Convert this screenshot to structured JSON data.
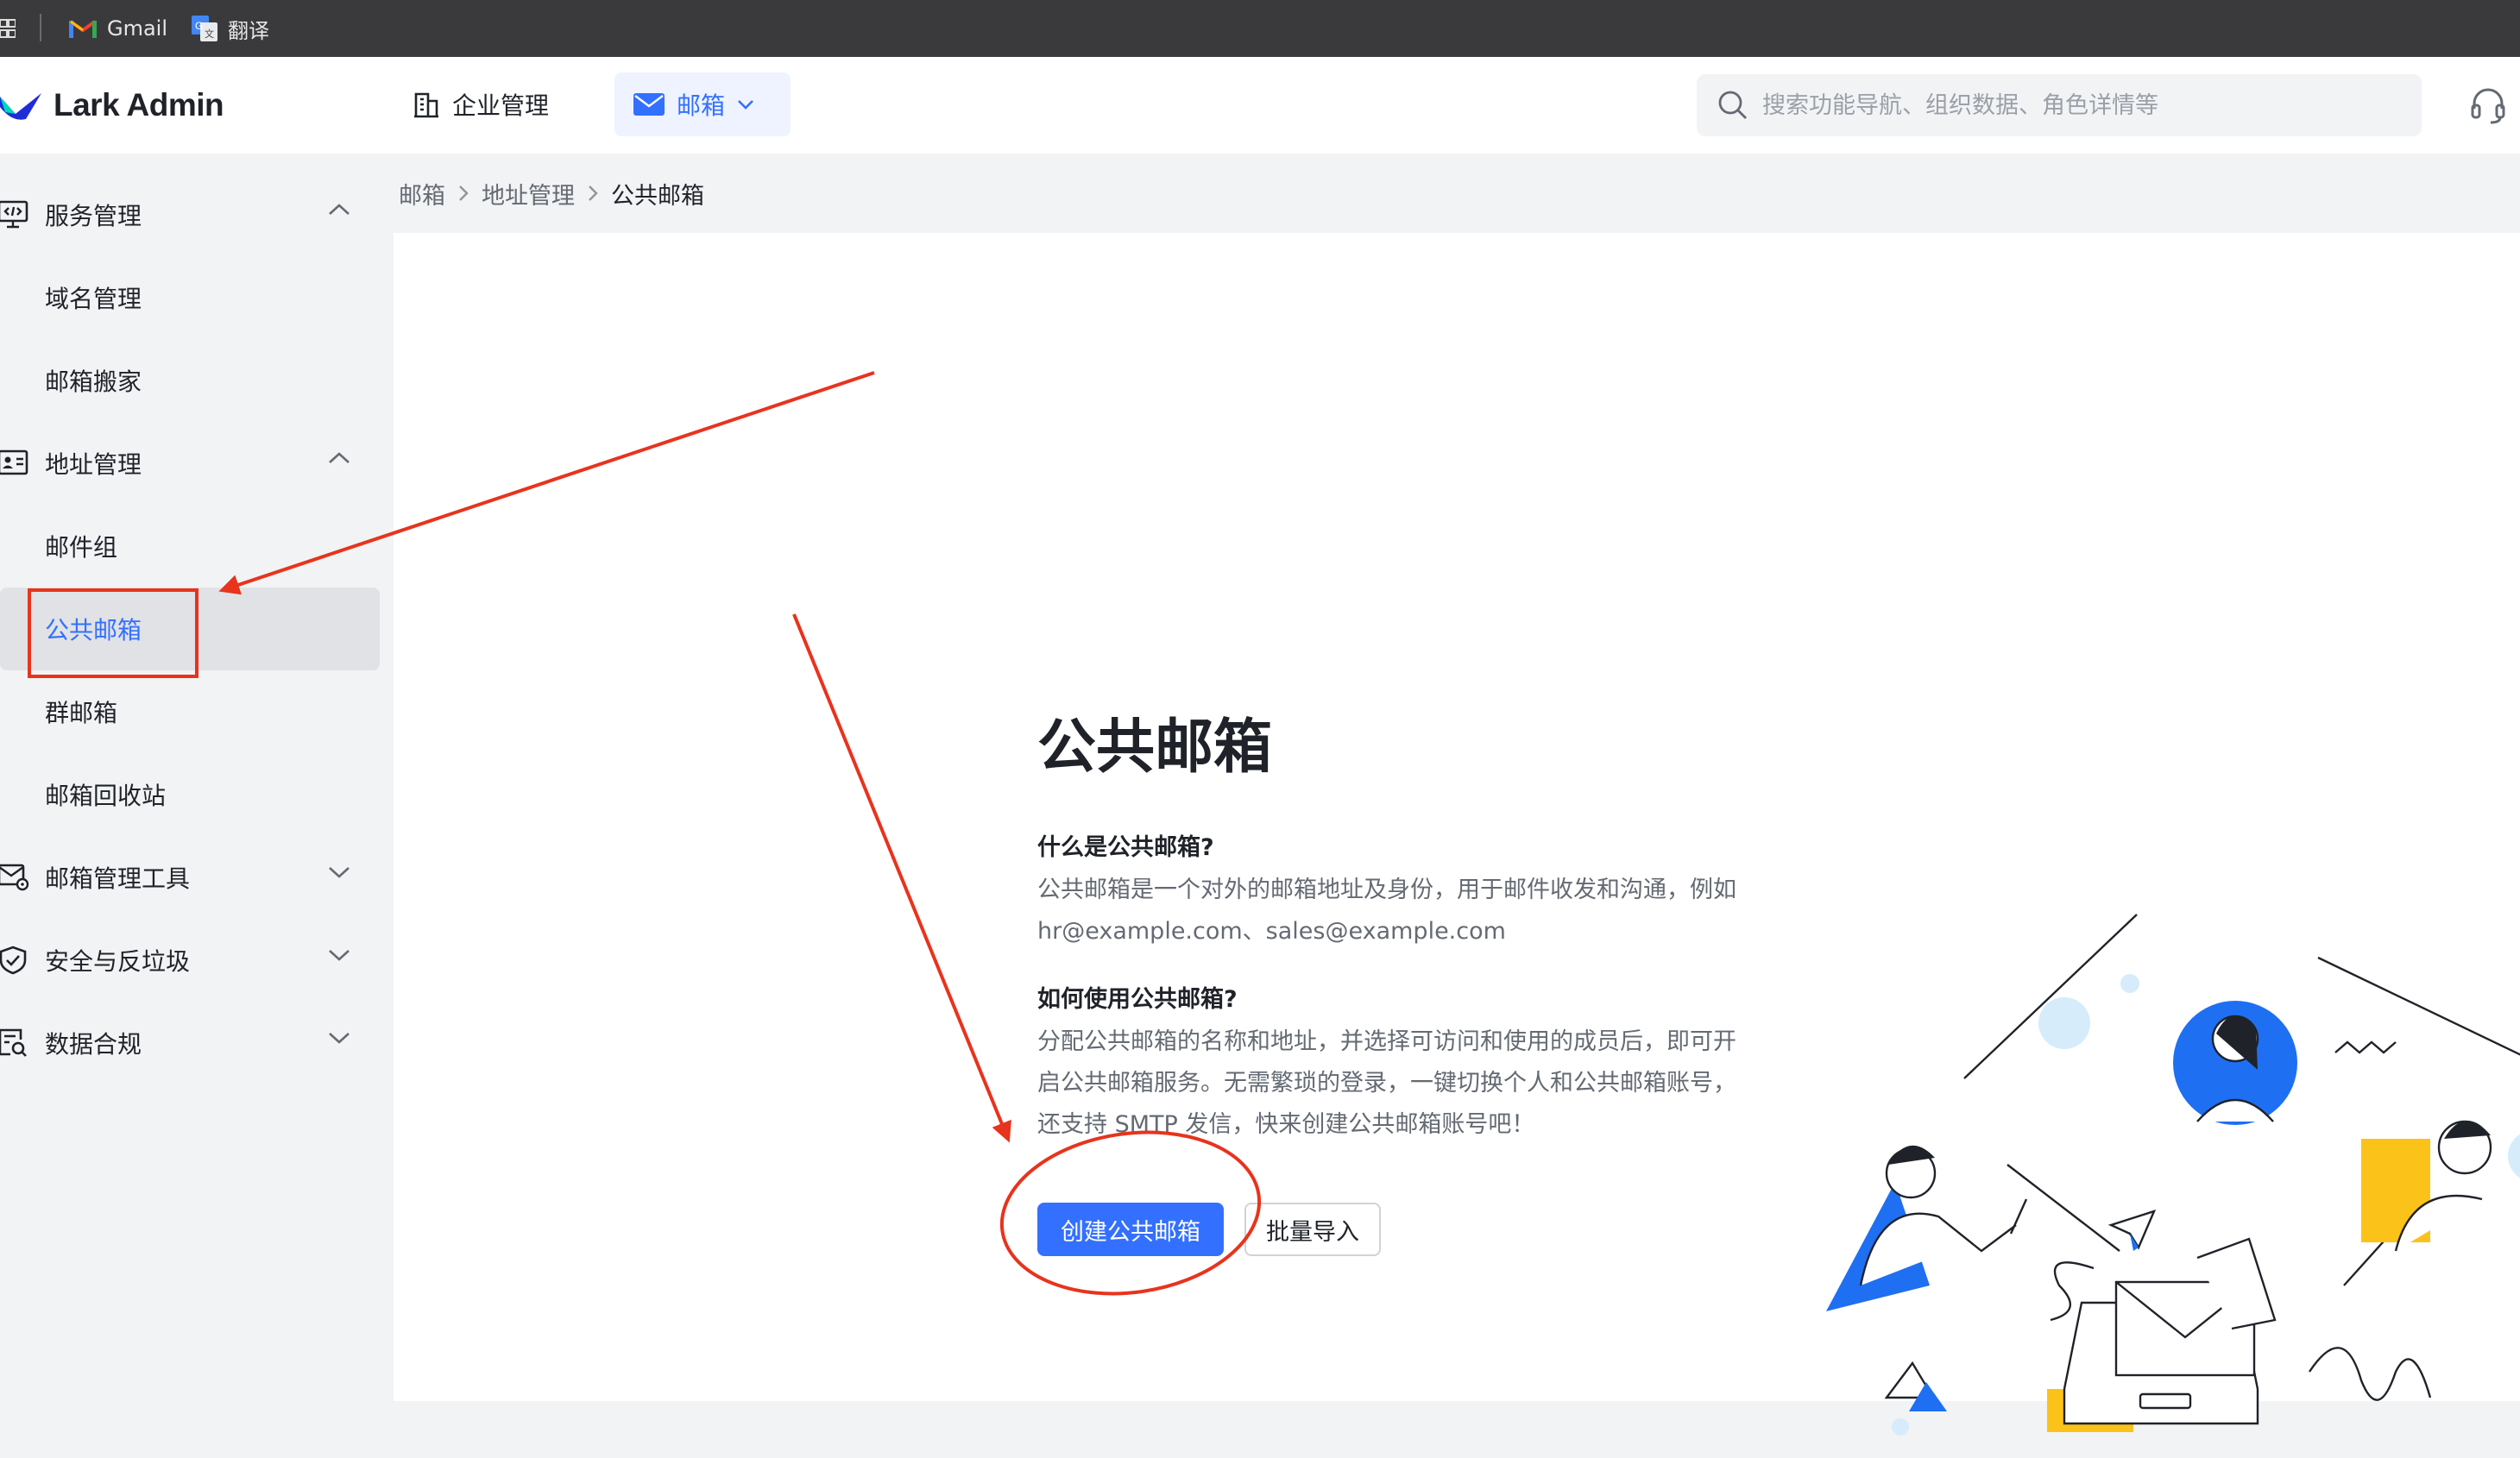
{
  "bookmarks": [
    {
      "label": "Gmail"
    },
    {
      "label": "翻译"
    }
  ],
  "header": {
    "logo": "Lark Admin",
    "nav_enterprise": "企业管理",
    "nav_mail": "邮箱",
    "search_placeholder": "搜索功能导航、组织数据、角色详情等"
  },
  "sidebar": {
    "groups": [
      {
        "label": "服务管理",
        "items": [
          "域名管理",
          "邮箱搬家"
        ]
      },
      {
        "label": "地址管理",
        "items": [
          "邮件组",
          "公共邮箱",
          "群邮箱",
          "邮箱回收站"
        ]
      },
      {
        "label": "邮箱管理工具"
      },
      {
        "label": "安全与反垃圾"
      },
      {
        "label": "数据合规"
      }
    ],
    "active_item": "公共邮箱"
  },
  "breadcrumb": [
    "邮箱",
    "地址管理",
    "公共邮箱"
  ],
  "main": {
    "title": "公共邮箱",
    "q1": "什么是公共邮箱?",
    "a1_line1": "公共邮箱是一个对外的邮箱地址及身份，用于邮件收发和沟通，例如",
    "a1_line2": "hr@example.com、sales@example.com",
    "q2": "如何使用公共邮箱?",
    "a2_line1": "分配公共邮箱的名称和地址，并选择可访问和使用的成员后，即可开",
    "a2_line2": "启公共邮箱服务。无需繁琐的登录，一键切换个人和公共邮箱账号，",
    "a2_line3": "还支持 SMTP 发信，快来创建公共邮箱账号吧！",
    "create_button": "创建公共邮箱",
    "import_button": "批量导入"
  },
  "colors": {
    "accent": "#3370ff",
    "annotation": "#e8331d"
  }
}
